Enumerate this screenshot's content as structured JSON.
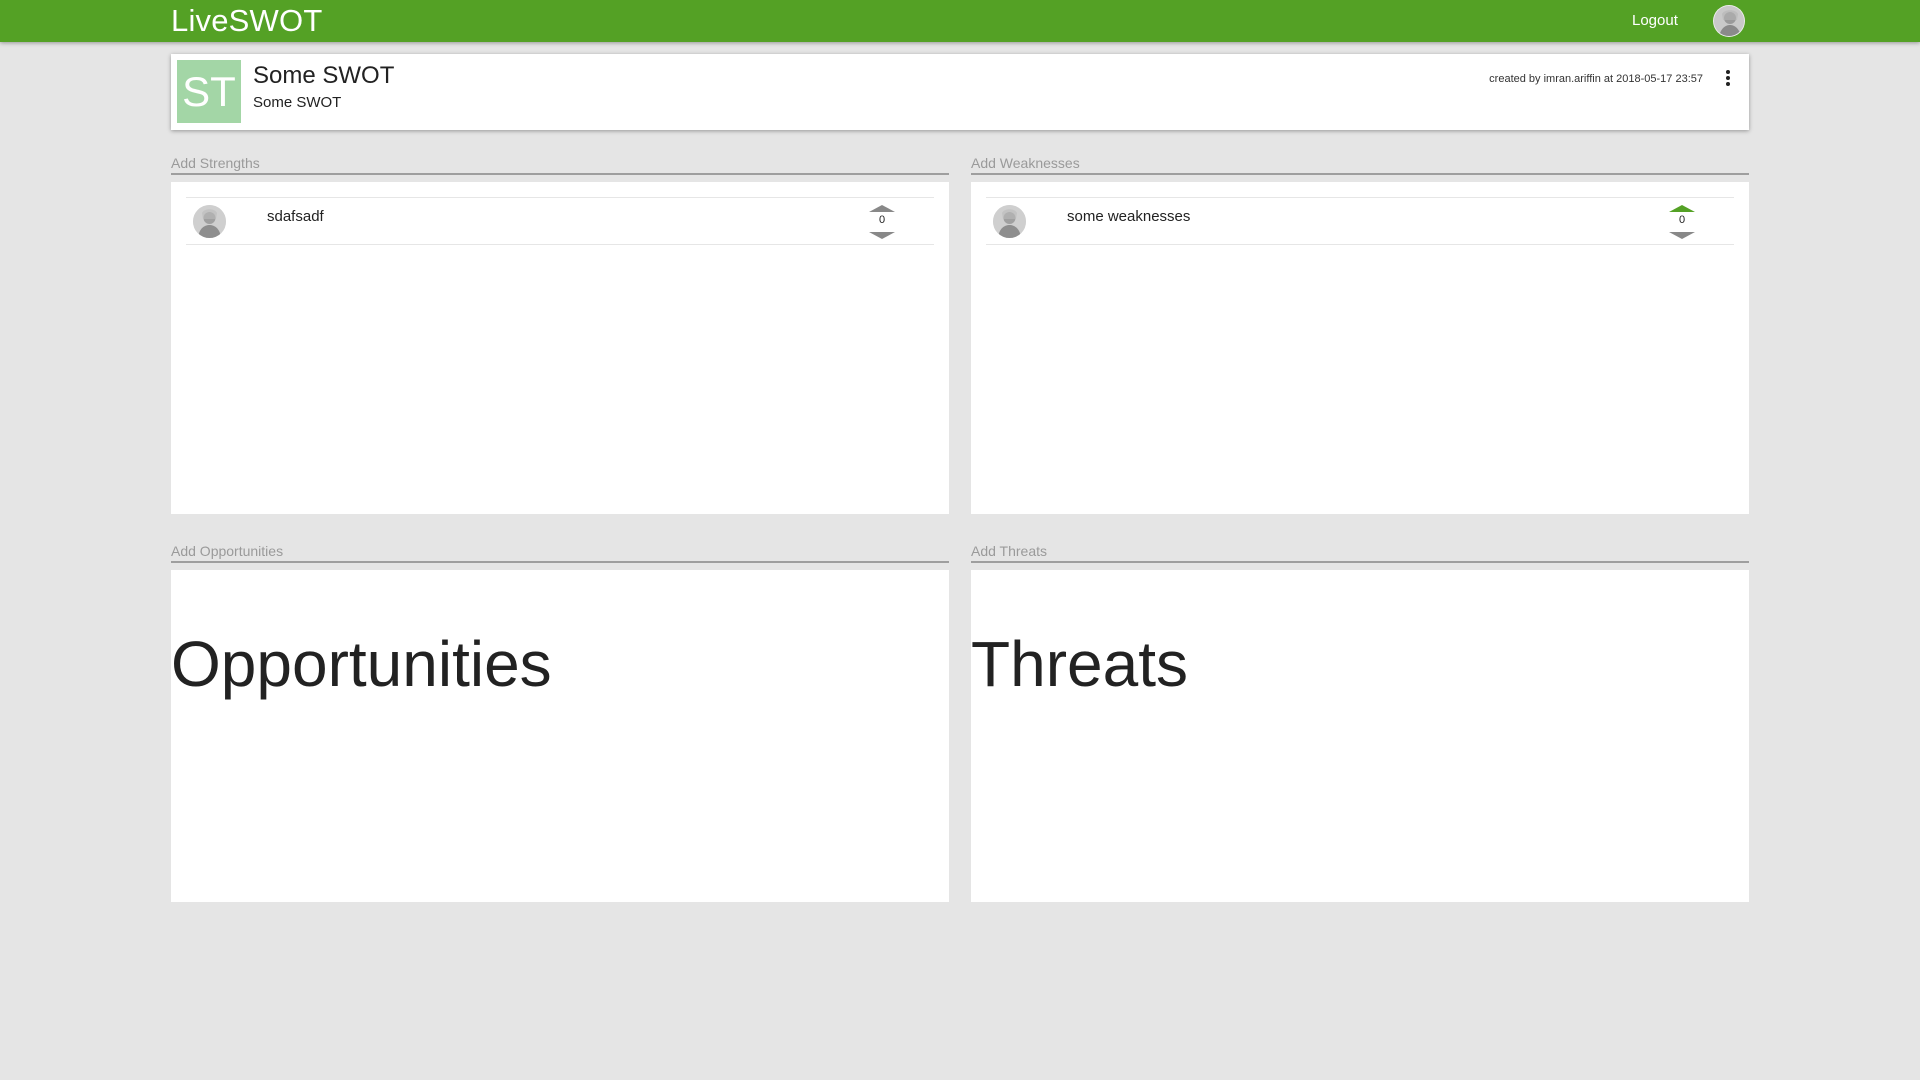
{
  "app": {
    "title": "LiveSWOT",
    "logout_label": "Logout",
    "brand_color": "#54a125"
  },
  "swot": {
    "initials": "ST",
    "initials_bg": "#a3d6a6",
    "title": "Some SWOT",
    "subtitle": "Some SWOT",
    "created_by": "created by imran.ariffin at 2018-05-17 23:57",
    "menu_icon": "more-vert-icon"
  },
  "quadrants": {
    "strengths": {
      "add_label": "Add Strengths",
      "items": [
        {
          "text": "sdafsadf",
          "votes": "0",
          "upvoted": false
        }
      ]
    },
    "weaknesses": {
      "add_label": "Add Weaknesses",
      "items": [
        {
          "text": "some weaknesses",
          "votes": "0",
          "upvoted": true
        }
      ]
    },
    "opportunities": {
      "add_label": "Add Opportunities",
      "placeholder": "Opportunities"
    },
    "threats": {
      "add_label": "Add Threats",
      "placeholder": "Threats"
    }
  }
}
